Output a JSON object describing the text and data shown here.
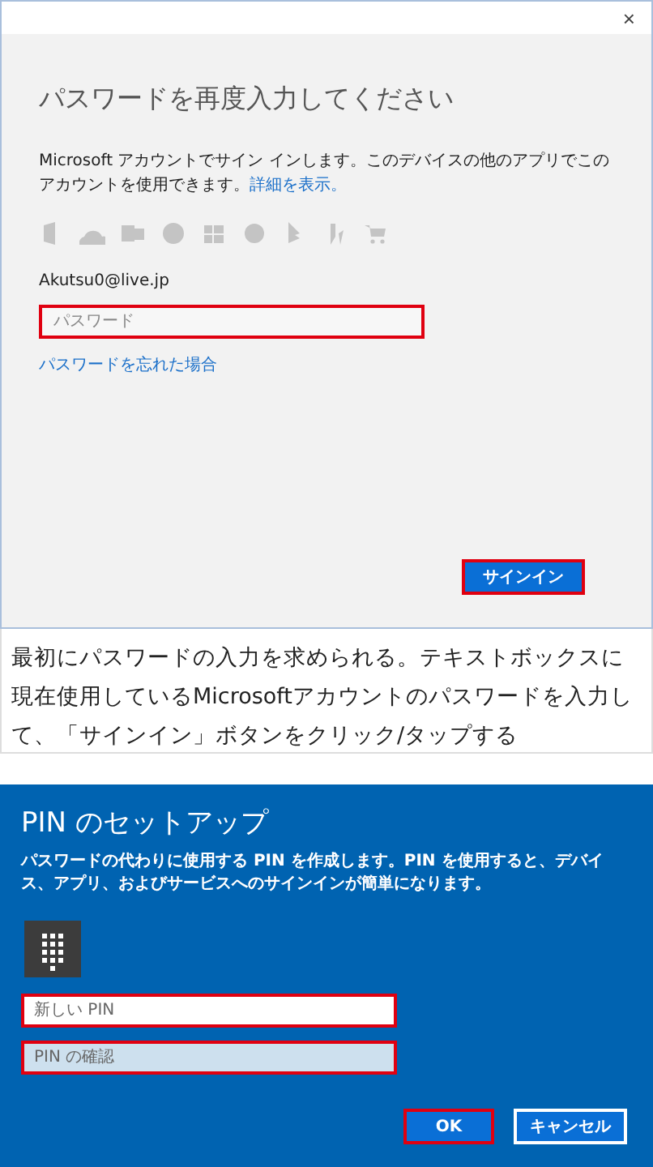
{
  "signin_dialog": {
    "close": "×",
    "title": "パスワードを再度入力してください",
    "description": "Microsoft アカウントでサイン インします。このデバイスの他のアプリでこのアカウントを使用できます。",
    "details_link": "詳細を表示。",
    "account": "Akutsu0@live.jp",
    "password_field": {
      "placeholder": "パスワード",
      "highlighted": true
    },
    "forgot_link": "パスワードを忘れた場合",
    "signin_button": {
      "label": "サインイン",
      "highlighted": true
    }
  },
  "caption": "最初にパスワードの入力を求められる。テキストボックスに現在使用しているMicrosoftアカウントのパスワードを入力して、「サインイン」ボタンをクリック/タップする",
  "pin_dialog": {
    "title": "PIN のセットアップ",
    "description": "パスワードの代わりに使用する PIN を作成します。PIN を使用すると、デバイス、アプリ、およびサービスへのサインインが簡単になります。",
    "fields": [
      {
        "placeholder": "新しい PIN",
        "highlighted": true,
        "focused": false
      },
      {
        "placeholder": "PIN の確認",
        "highlighted": true,
        "focused": true
      }
    ],
    "buttons": [
      {
        "label": "OK",
        "highlighted": true
      },
      {
        "label": "キャンセル",
        "highlighted": false
      }
    ]
  }
}
